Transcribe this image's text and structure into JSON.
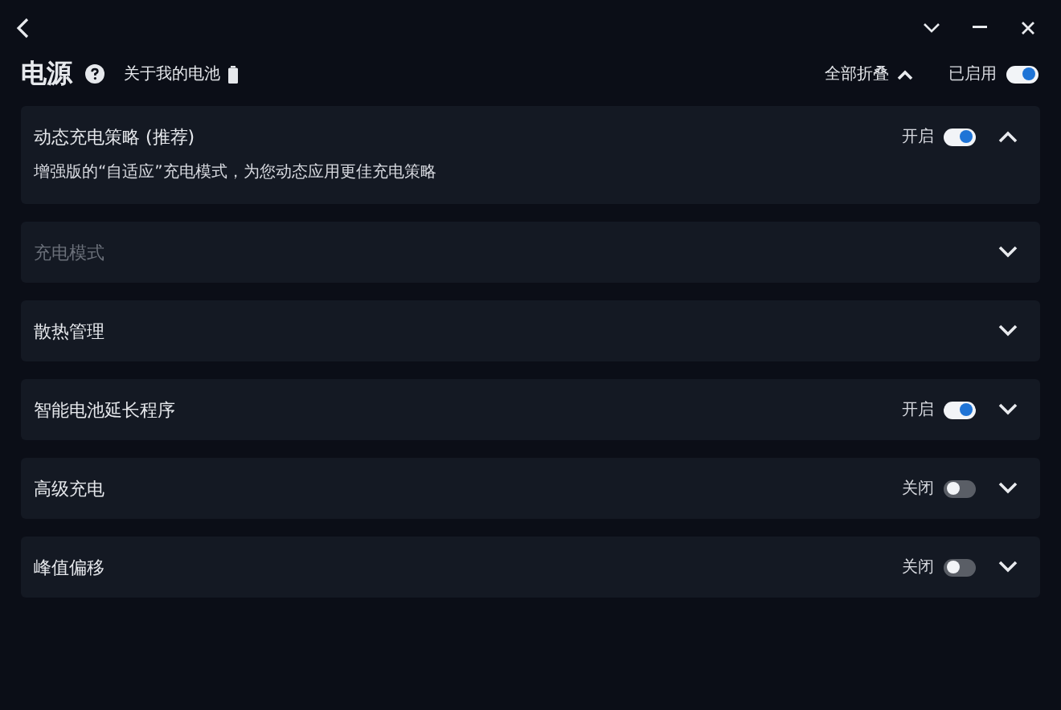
{
  "header": {
    "title": "电源",
    "about_link": "关于我的电池"
  },
  "collapse_all": {
    "label": "全部折叠"
  },
  "master": {
    "label": "已启用",
    "on": true
  },
  "sections": [
    {
      "title": "动态充电策略 (推荐)",
      "disabled": false,
      "expanded": true,
      "toggle": {
        "label": "开启",
        "on": true
      },
      "description": "增强版的“自适应”充电模式，为您动态应用更佳充电策略"
    },
    {
      "title": "充电模式",
      "disabled": true,
      "expanded": false
    },
    {
      "title": "散热管理",
      "disabled": false,
      "expanded": false
    },
    {
      "title": "智能电池延长程序",
      "disabled": false,
      "expanded": false,
      "toggle": {
        "label": "开启",
        "on": true
      }
    },
    {
      "title": "高级充电",
      "disabled": false,
      "expanded": false,
      "toggle": {
        "label": "关闭",
        "on": false
      }
    },
    {
      "title": "峰值偏移",
      "disabled": false,
      "expanded": false,
      "toggle": {
        "label": "关闭",
        "on": false
      }
    }
  ]
}
